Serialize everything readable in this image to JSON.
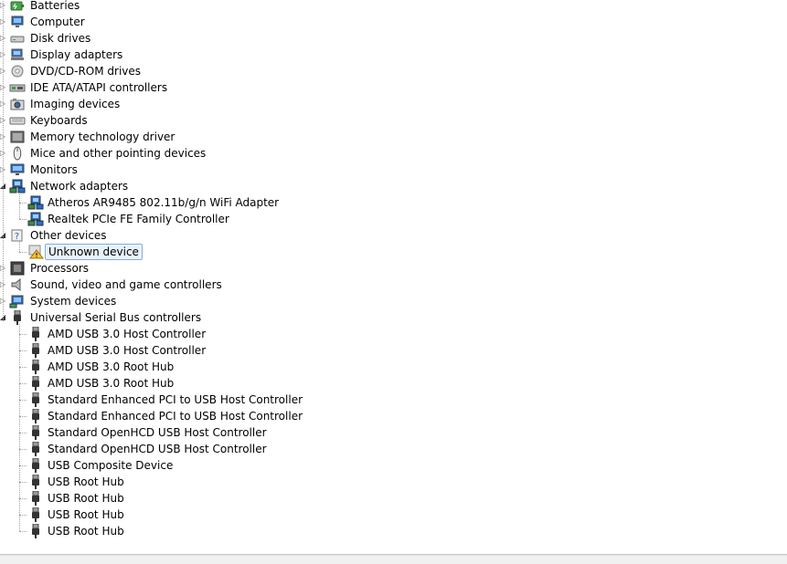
{
  "tree": [
    {
      "label": "Batteries",
      "icon": "battery-icon",
      "expanded": false
    },
    {
      "label": "Computer",
      "icon": "computer-icon",
      "expanded": false
    },
    {
      "label": "Disk drives",
      "icon": "disk-drive-icon",
      "expanded": false
    },
    {
      "label": "Display adapters",
      "icon": "display-adapter-icon",
      "expanded": false
    },
    {
      "label": "DVD/CD-ROM drives",
      "icon": "dvd-drive-icon",
      "expanded": false
    },
    {
      "label": "IDE ATA/ATAPI controllers",
      "icon": "ide-controller-icon",
      "expanded": false
    },
    {
      "label": "Imaging devices",
      "icon": "camera-icon",
      "expanded": false
    },
    {
      "label": "Keyboards",
      "icon": "keyboard-icon",
      "expanded": false
    },
    {
      "label": "Memory technology driver",
      "icon": "memory-card-icon",
      "expanded": false
    },
    {
      "label": "Mice and other pointing devices",
      "icon": "mouse-icon",
      "expanded": false
    },
    {
      "label": "Monitors",
      "icon": "monitor-icon",
      "expanded": false
    },
    {
      "label": "Network adapters",
      "icon": "network-adapter-icon",
      "expanded": true,
      "children": [
        {
          "label": "Atheros AR9485 802.11b/g/n WiFi Adapter",
          "icon": "network-adapter-icon"
        },
        {
          "label": "Realtek PCIe FE Family Controller",
          "icon": "network-adapter-icon"
        }
      ]
    },
    {
      "label": "Other devices",
      "icon": "unknown-device-icon",
      "expanded": true,
      "children": [
        {
          "label": "Unknown device",
          "icon": "warning-device-icon",
          "selected": true
        }
      ]
    },
    {
      "label": "Processors",
      "icon": "processor-icon",
      "expanded": false
    },
    {
      "label": "Sound, video and game controllers",
      "icon": "speaker-icon",
      "expanded": false
    },
    {
      "label": "System devices",
      "icon": "system-device-icon",
      "expanded": false
    },
    {
      "label": "Universal Serial Bus controllers",
      "icon": "usb-plug-icon",
      "expanded": true,
      "children": [
        {
          "label": "AMD USB 3.0 Host Controller",
          "icon": "usb-plug-icon"
        },
        {
          "label": "AMD USB 3.0 Host Controller",
          "icon": "usb-plug-icon"
        },
        {
          "label": "AMD USB 3.0 Root Hub",
          "icon": "usb-plug-icon"
        },
        {
          "label": "AMD USB 3.0 Root Hub",
          "icon": "usb-plug-icon"
        },
        {
          "label": "Standard Enhanced PCI to USB Host Controller",
          "icon": "usb-plug-icon"
        },
        {
          "label": "Standard Enhanced PCI to USB Host Controller",
          "icon": "usb-plug-icon"
        },
        {
          "label": "Standard OpenHCD USB Host Controller",
          "icon": "usb-plug-icon"
        },
        {
          "label": "Standard OpenHCD USB Host Controller",
          "icon": "usb-plug-icon"
        },
        {
          "label": "USB Composite Device",
          "icon": "usb-plug-icon"
        },
        {
          "label": "USB Root Hub",
          "icon": "usb-plug-icon"
        },
        {
          "label": "USB Root Hub",
          "icon": "usb-plug-icon"
        },
        {
          "label": "USB Root Hub",
          "icon": "usb-plug-icon"
        },
        {
          "label": "USB Root Hub",
          "icon": "usb-plug-icon"
        }
      ]
    }
  ],
  "colors": {
    "selection_bg": "#e8f2fd",
    "selection_border": "#84acdd",
    "tree_line": "#a0a0a0"
  }
}
